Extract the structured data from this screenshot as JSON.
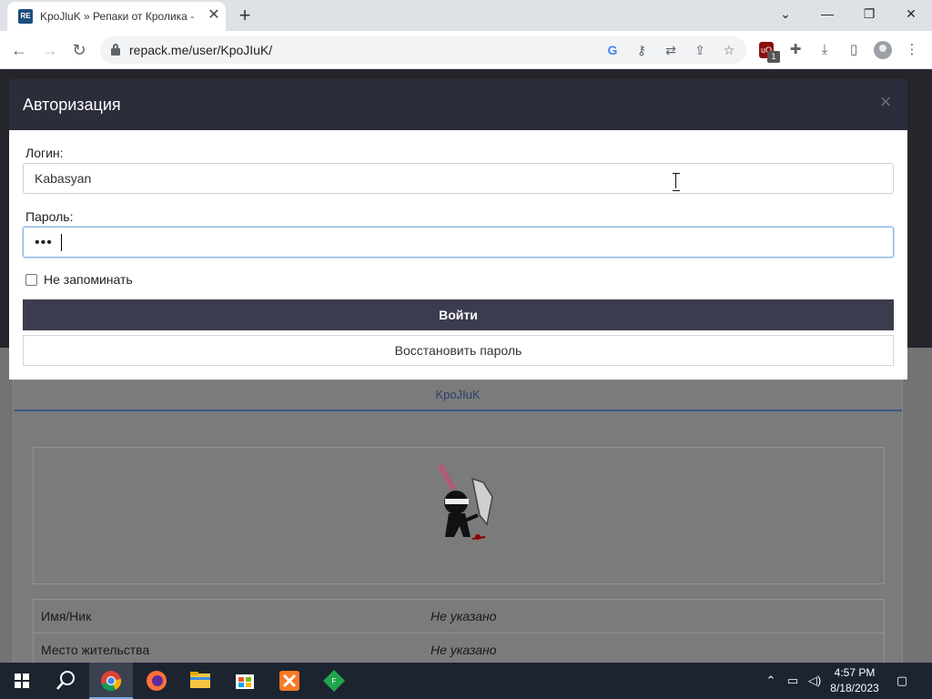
{
  "browser": {
    "tab_title": "KpoJluK » Репаки от Кролика - I",
    "tab_favicon_text": "RE",
    "url": "repack.me/user/KpoJIuK/",
    "icons": [
      "google-icon",
      "key-icon",
      "translate-icon",
      "share-icon",
      "star-icon",
      "ublock-icon",
      "extensions-icon",
      "download-icon",
      "sidepanel-icon",
      "profile-icon",
      "menu-icon"
    ],
    "ublock_badge": "1"
  },
  "modal": {
    "title": "Авторизация",
    "login_label": "Логин:",
    "login_value": "Kabasyan",
    "password_label": "Пароль:",
    "password_mask": "•••",
    "remember_label": "Не запоминать",
    "remember_checked": false,
    "login_button": "Войти",
    "restore_button": "Восстановить пароль"
  },
  "profile": {
    "tab_label": "KpoJIuK",
    "rows": [
      {
        "key": "Имя/Ник",
        "value": "Не указано"
      },
      {
        "key": "Место жительства",
        "value": "Не указано"
      }
    ]
  },
  "taskbar": {
    "apps": [
      "start-icon",
      "search-icon",
      "chrome-icon",
      "firefox-icon",
      "file-explorer-icon",
      "store-icon",
      "xampp-icon",
      "green-app-icon"
    ],
    "time": "4:57 PM",
    "date": "8/18/2023"
  },
  "colors": {
    "modal_header": "#2c2d3b",
    "login_button": "#3b3c4d",
    "taskbar": "#1c2430"
  }
}
